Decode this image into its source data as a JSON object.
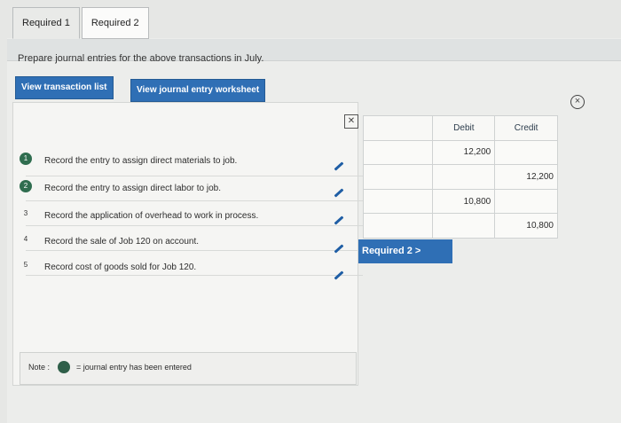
{
  "tabs": [
    {
      "label": "Required 1"
    },
    {
      "label": "Required 2"
    }
  ],
  "instruction": "Prepare journal entries for the above transactions in July.",
  "buttons": {
    "view_transaction_list": "View transaction list",
    "view_journal_entry_worksheet": "View journal entry worksheet",
    "required2": "Required 2 >"
  },
  "entries": [
    {
      "badge": "1",
      "text": "Record the entry to assign direct materials to job."
    },
    {
      "badge": "2",
      "text": "Record the entry to assign direct labor to job."
    },
    {
      "badge": "3",
      "text": "Record the application of overhead to work in process."
    },
    {
      "badge": "4",
      "text": "Record the sale of Job 120 on account."
    },
    {
      "badge": "5",
      "text": "Record cost of goods sold for Job 120."
    }
  ],
  "note": {
    "label": "Note :",
    "text": "= journal entry has been entered"
  },
  "worksheet_table": {
    "headers": {
      "debit": "Debit",
      "credit": "Credit"
    },
    "rows": [
      {
        "debit": "12,200",
        "credit": ""
      },
      {
        "debit": "",
        "credit": "12,200"
      },
      {
        "debit": "10,800",
        "credit": ""
      },
      {
        "debit": "",
        "credit": "10,800"
      }
    ]
  },
  "icons": {
    "close": "close-icon",
    "worksheet": "worksheet-icon",
    "edit": "pencil-icon"
  }
}
